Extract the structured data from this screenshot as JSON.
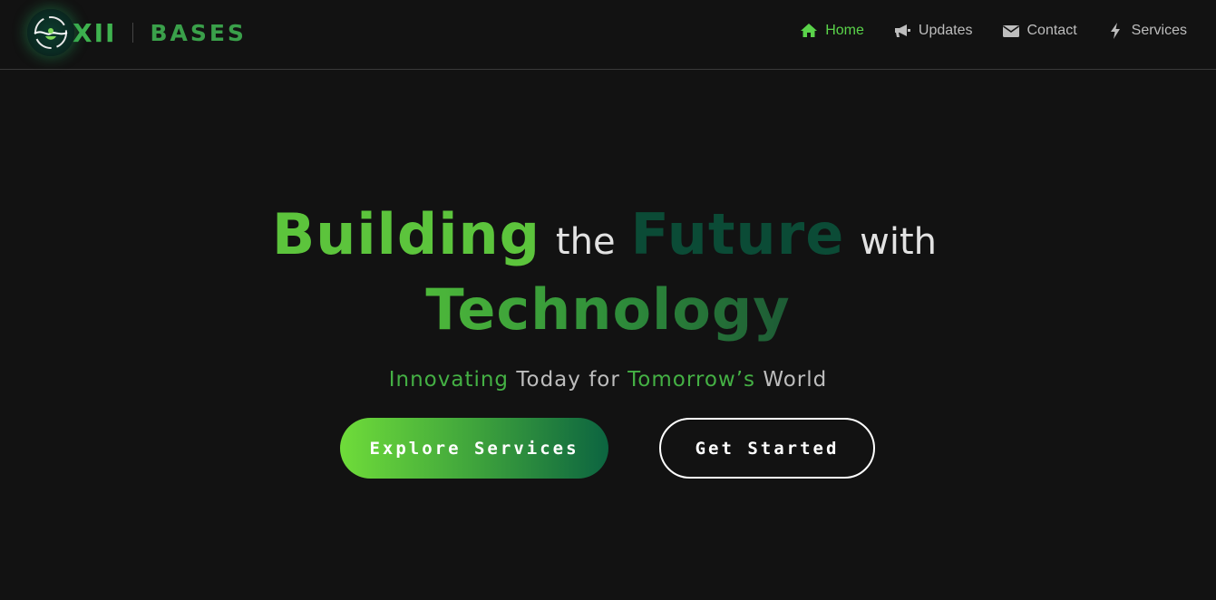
{
  "brand": {
    "logo_text": "XII",
    "name": "BASES"
  },
  "nav": {
    "items": [
      {
        "label": "Home",
        "icon": "home-icon",
        "active": true
      },
      {
        "label": "Updates",
        "icon": "megaphone-icon",
        "active": false
      },
      {
        "label": "Contact",
        "icon": "envelope-icon",
        "active": false
      },
      {
        "label": "Services",
        "icon": "bolt-icon",
        "active": false
      }
    ]
  },
  "hero": {
    "headline": {
      "word1": "Building",
      "word2": "the",
      "word3": "Future",
      "word4": "with",
      "word5": "Technology"
    },
    "tagline": {
      "part1": "Innovating",
      "part2": "Today for",
      "part3": "Tomorrow’s",
      "part4": "World"
    },
    "buttons": {
      "explore_label": "Explore Services",
      "start_label": "Get Started"
    }
  },
  "colors": {
    "background": "#121212",
    "accent": "#5ad34a",
    "nav_text": "#bdbdbd"
  }
}
